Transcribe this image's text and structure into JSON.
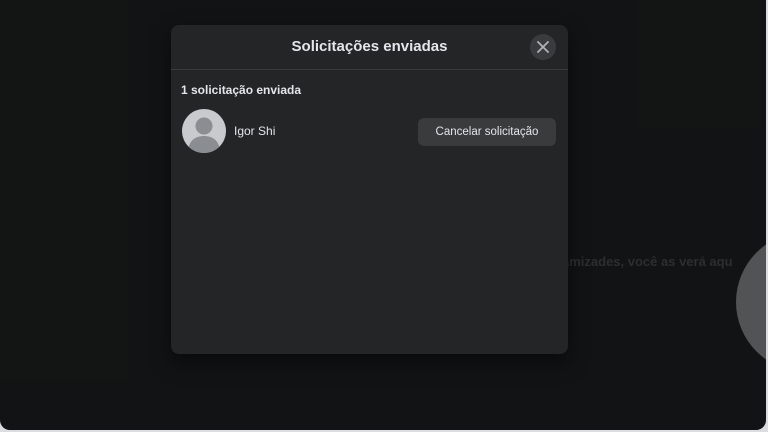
{
  "background": {
    "partial_text": "amizades, você as verá aqu"
  },
  "modal": {
    "title": "Solicitações enviadas",
    "close_icon": "close-icon",
    "count_label": "1 solicitação enviada",
    "requests": [
      {
        "name": "Igor Shi",
        "avatar_icon": "default-avatar-icon",
        "action_label": "Cancelar solicitação"
      }
    ]
  },
  "colors": {
    "page_background": "#18191a",
    "modal_background": "#242526",
    "button_background": "#3a3b3c",
    "primary_text": "#e4e6eb"
  }
}
